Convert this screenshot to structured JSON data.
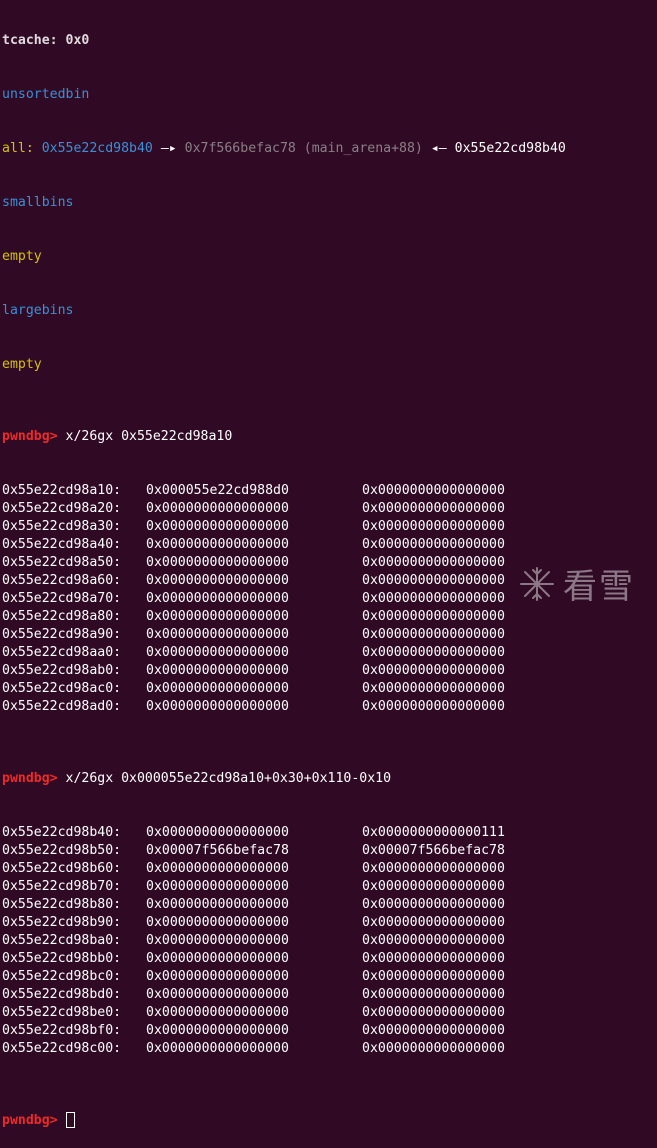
{
  "header": {
    "partial_top": "tcache: 0x0",
    "unsortedbin_label": "unsortedbin",
    "all_label": "all:",
    "all_addr": "0x55e22cd98b40",
    "arrow_right": "—▸",
    "arena_addr": "0x7f566befac78",
    "arena_sym": "(main_arena+88)",
    "arrow_left": "◂—",
    "all_addr2": "0x55e22cd98b40",
    "smallbins_label": "smallbins",
    "smallbins_value": "empty",
    "largebins_label": "largebins",
    "largebins_value": "empty"
  },
  "prompt": "pwndbg>",
  "cmd1": "x/26gx 0x55e22cd98a10",
  "dump1": [
    [
      "0x55e22cd98a10:",
      "0x000055e22cd988d0",
      "0x0000000000000000"
    ],
    [
      "0x55e22cd98a20:",
      "0x0000000000000000",
      "0x0000000000000000"
    ],
    [
      "0x55e22cd98a30:",
      "0x0000000000000000",
      "0x0000000000000000"
    ],
    [
      "0x55e22cd98a40:",
      "0x0000000000000000",
      "0x0000000000000000"
    ],
    [
      "0x55e22cd98a50:",
      "0x0000000000000000",
      "0x0000000000000000"
    ],
    [
      "0x55e22cd98a60:",
      "0x0000000000000000",
      "0x0000000000000000"
    ],
    [
      "0x55e22cd98a70:",
      "0x0000000000000000",
      "0x0000000000000000"
    ],
    [
      "0x55e22cd98a80:",
      "0x0000000000000000",
      "0x0000000000000000"
    ],
    [
      "0x55e22cd98a90:",
      "0x0000000000000000",
      "0x0000000000000000"
    ],
    [
      "0x55e22cd98aa0:",
      "0x0000000000000000",
      "0x0000000000000000"
    ],
    [
      "0x55e22cd98ab0:",
      "0x0000000000000000",
      "0x0000000000000000"
    ],
    [
      "0x55e22cd98ac0:",
      "0x0000000000000000",
      "0x0000000000000000"
    ],
    [
      "0x55e22cd98ad0:",
      "0x0000000000000000",
      "0x0000000000000000"
    ]
  ],
  "cmd2": "x/26gx 0x000055e22cd98a10+0x30+0x110-0x10",
  "dump2": [
    [
      "0x55e22cd98b40:",
      "0x0000000000000000",
      "0x0000000000000111"
    ],
    [
      "0x55e22cd98b50:",
      "0x00007f566befac78",
      "0x00007f566befac78"
    ],
    [
      "0x55e22cd98b60:",
      "0x0000000000000000",
      "0x0000000000000000"
    ],
    [
      "0x55e22cd98b70:",
      "0x0000000000000000",
      "0x0000000000000000"
    ],
    [
      "0x55e22cd98b80:",
      "0x0000000000000000",
      "0x0000000000000000"
    ],
    [
      "0x55e22cd98b90:",
      "0x0000000000000000",
      "0x0000000000000000"
    ],
    [
      "0x55e22cd98ba0:",
      "0x0000000000000000",
      "0x0000000000000000"
    ],
    [
      "0x55e22cd98bb0:",
      "0x0000000000000000",
      "0x0000000000000000"
    ],
    [
      "0x55e22cd98bc0:",
      "0x0000000000000000",
      "0x0000000000000000"
    ],
    [
      "0x55e22cd98bd0:",
      "0x0000000000000000",
      "0x0000000000000000"
    ],
    [
      "0x55e22cd98be0:",
      "0x0000000000000000",
      "0x0000000000000000"
    ],
    [
      "0x55e22cd98bf0:",
      "0x0000000000000000",
      "0x0000000000000000"
    ],
    [
      "0x55e22cd98c00:",
      "0x0000000000000000",
      "0x0000000000000000"
    ]
  ],
  "watermark": {
    "text": "看雪",
    "icon": "kanxue-logo-icon"
  },
  "colors": {
    "background": "#300a24",
    "blue": "#3a8fd6",
    "gray": "#8a7f86",
    "yellow": "#d4c200",
    "prompt_red": "#ef2929"
  }
}
